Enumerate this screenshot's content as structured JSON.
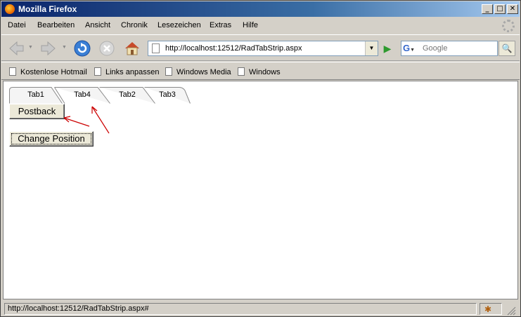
{
  "window": {
    "title": "Mozilla Firefox"
  },
  "menu": [
    "Datei",
    "Bearbeiten",
    "Ansicht",
    "Chronik",
    "Lesezeichen",
    "Extras",
    "Hilfe"
  ],
  "nav": {
    "url": "http://localhost:12512/RadTabStrip.aspx",
    "search_placeholder": "Google"
  },
  "bookmarks": [
    "Kostenlose Hotmail",
    "Links anpassen",
    "Windows Media",
    "Windows"
  ],
  "tabs": [
    "Tab1",
    "Tab4",
    "Tab2",
    "Tab3"
  ],
  "buttons": {
    "postback": "Postback",
    "change_position": "Change Position"
  },
  "status": {
    "text": "http://localhost:12512/RadTabStrip.aspx#"
  },
  "colors": {
    "titlebar_start": "#0a246a",
    "titlebar_end": "#a6caf0",
    "annotation": "#cc0000"
  }
}
